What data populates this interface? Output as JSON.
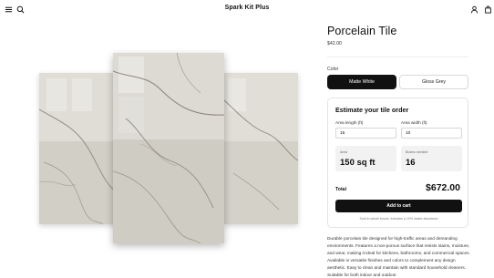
{
  "header": {
    "brand": "Spark Kit Plus",
    "menu_icon": "menu-icon",
    "search_icon": "search-icon",
    "account_icon": "user-icon",
    "cart_icon": "shopping-bag-icon"
  },
  "product": {
    "title": "Porcelain Tile",
    "price": "$42.00",
    "image_alt": "Porcelain marble-look tiles"
  },
  "color": {
    "label": "Color",
    "options": [
      {
        "label": "Matte White",
        "selected": true
      },
      {
        "label": "Gloss Grey",
        "selected": false
      }
    ]
  },
  "estimator": {
    "title": "Estimate your tile order",
    "length_label": "Area length (ft)",
    "length_value": "15",
    "width_label": "Area width (ft)",
    "width_value": "10",
    "area_label": "Area",
    "area_value": "150 sq ft",
    "boxes_label": "Boxes needed",
    "boxes_value": "16",
    "total_label": "Total",
    "total_value": "$672.00",
    "cart_button": "Add to cart",
    "note": "Sold in whole boxes. Includes a 10% waste allowance"
  },
  "description": "Durable porcelain tile designed for high-traffic areas and demanding environments. Features a non-porous surface that resists stains, moisture, and wear, making it ideal for kitchens, bathrooms, and commercial spaces. Available in versatile finishes and colors to complement any design aesthetic. Easy to clean and maintain with standard household cleaners. Suitable for both indoor and outdoor"
}
